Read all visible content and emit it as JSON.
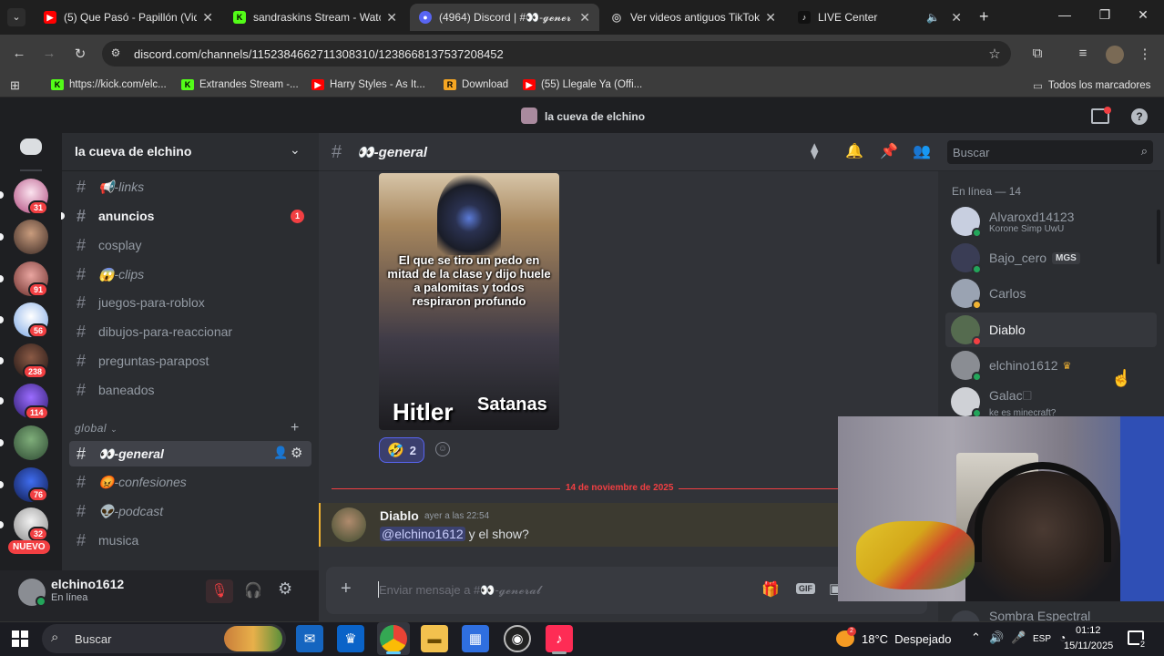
{
  "browser": {
    "tabs": [
      {
        "title": "(5) Que Pasó - Papillón (Vid",
        "icon": "youtube-icon",
        "color": "#ff0000"
      },
      {
        "title": "sandraskins Stream - Watch",
        "icon": "kick-icon",
        "color": "#53fc18"
      },
      {
        "title": "(4964) Discord | #👀-𝓰𝓮𝓷𝓮𝓻",
        "icon": "discord-icon",
        "color": "#5865f2"
      },
      {
        "title": "Ver videos antiguos TikTok",
        "icon": "globe-icon",
        "color": "#8ab4f8"
      },
      {
        "title": "LIVE Center",
        "icon": "tiktok-icon",
        "color": "#000000"
      }
    ],
    "url": "discord.com/channels/1152384662711308310/1238668137537208452",
    "bookmarks": [
      {
        "label": "https://kick.com/elc...",
        "icon": "kick-icon",
        "color": "#53fc18"
      },
      {
        "label": "Extrandes Stream -...",
        "icon": "kick-icon",
        "color": "#53fc18"
      },
      {
        "label": "Harry Styles - As It...",
        "icon": "youtube-icon",
        "color": "#ff0000"
      },
      {
        "label": "Download",
        "icon": "download-icon",
        "color": "#f5a623"
      },
      {
        "label": "(55) Llegale Ya (Offi...",
        "icon": "youtube-icon",
        "color": "#ff0000"
      }
    ],
    "all_bookmarks": "Todos los marcadores"
  },
  "discord": {
    "window_title": "la cueva de elchino",
    "server_name": "la cueva de elchino",
    "guild_badges": [
      "31",
      "91",
      "56",
      "238",
      "114",
      "76",
      "32"
    ],
    "new_label": "NUEVO",
    "channels": [
      {
        "name": "📢-links",
        "bold": false
      },
      {
        "name": "anuncios",
        "bold": true,
        "badge": "1"
      },
      {
        "name": "cosplay",
        "bold": false
      },
      {
        "name": "😱-clips",
        "bold": false
      },
      {
        "name": "juegos-para-roblox",
        "bold": false
      },
      {
        "name": "dibujos-para-reaccionar",
        "bold": false
      },
      {
        "name": "preguntas-parapost",
        "bold": false
      },
      {
        "name": "baneados",
        "bold": false
      }
    ],
    "category": "global",
    "channels2": [
      {
        "name": "👀-general",
        "selected": true
      },
      {
        "name": "😡-confesiones"
      },
      {
        "name": "👽-podcast"
      },
      {
        "name": "musica"
      }
    ],
    "current_channel": "👀-general",
    "search_placeholder": "Buscar",
    "user": {
      "name": "elchino1612",
      "status": "En línea"
    },
    "meme": {
      "caption": "El que se tiro un pedo en mitad de la clase y dijo huele a palomitas y todos respiraron profundo",
      "left_label": "Hitler",
      "right_label": "Satanas"
    },
    "reaction": {
      "emoji": "🤣",
      "count": "2"
    },
    "date_divider": "14 de noviembre de 2025",
    "message": {
      "author": "Diablo",
      "time": "ayer a las 22:54",
      "mention": "@elchino1612",
      "text": " y el show?"
    },
    "composer_placeholder": "Enviar mensaje a #👀-𝓰𝓮𝓷𝓮𝓻𝓪𝓵",
    "members_heading": "En línea — 14",
    "members": [
      {
        "name": "Alvaroxd14123",
        "sub": "Korone Simp UwU",
        "status": "#23a55a",
        "color": "#c8cfe0"
      },
      {
        "name": "Bajo_cero",
        "tag": "MGS",
        "status": "#23a55a",
        "color": "#3a3d55"
      },
      {
        "name": "Carlos",
        "status": "#f0b232",
        "color": "#9aa3b2"
      },
      {
        "name": "Diablo",
        "status": "#f23f42",
        "color": "#556b4f"
      },
      {
        "name": "elchino1612",
        "status": "#23a55a",
        "color": "#8a8d93"
      },
      {
        "name": "Galac🗆",
        "sub": "ke es minecraft?",
        "status": "#23a55a",
        "color": "#cfd1d6"
      }
    ],
    "member_bottom": "Sombra Espectral"
  },
  "taskbar": {
    "search": "Buscar",
    "weather": "18°C  Despejado",
    "lang": "ESP",
    "time": "01:12",
    "date": "15/11/2025",
    "notif_count": "2"
  }
}
